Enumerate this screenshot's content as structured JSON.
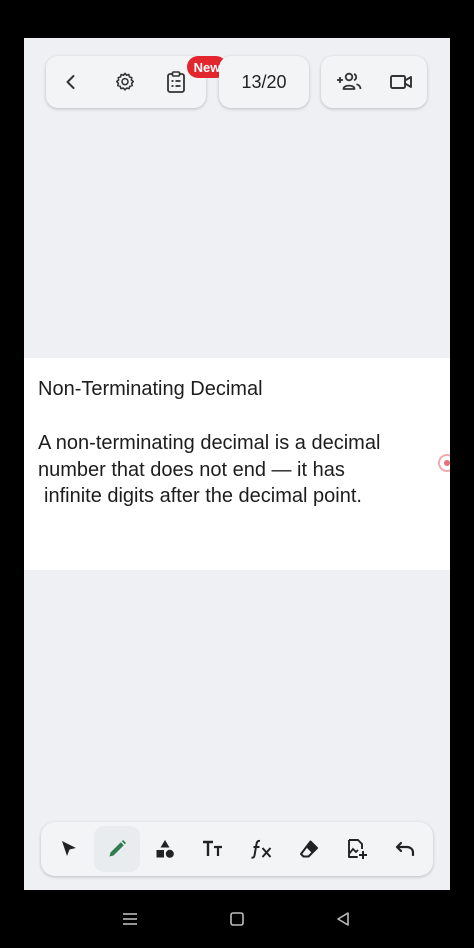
{
  "top_toolbar": {
    "back_icon": "chevron-left-icon",
    "settings_icon": "gear-icon",
    "clipboard_icon": "clipboard-list-icon",
    "new_badge": "New",
    "page_counter": "13/20",
    "add_participant_icon": "add-people-icon",
    "video_icon": "video-camera-icon"
  },
  "card": {
    "title": "Non-Terminating Decimal",
    "lines": [
      "A non-terminating decimal is a decimal",
      "number that does not end — it has",
      "infinite digits after the decimal point."
    ]
  },
  "bottom_toolbar": {
    "tools": [
      "select-pointer-icon",
      "pen-icon",
      "shapes-icon",
      "text-icon",
      "formula-icon",
      "eraser-icon",
      "add-image-icon",
      "undo-icon"
    ],
    "active_tool": "pen-icon",
    "accent_color": "#2e7d4f"
  },
  "nav_bar": {
    "menu_icon": "menu-icon",
    "home_icon": "home-square-icon",
    "back_icon": "back-triangle-icon"
  },
  "colors": {
    "badge_red": "#e3262d",
    "canvas_bg": "#eef0f3",
    "card_bg": "#ffffff"
  }
}
